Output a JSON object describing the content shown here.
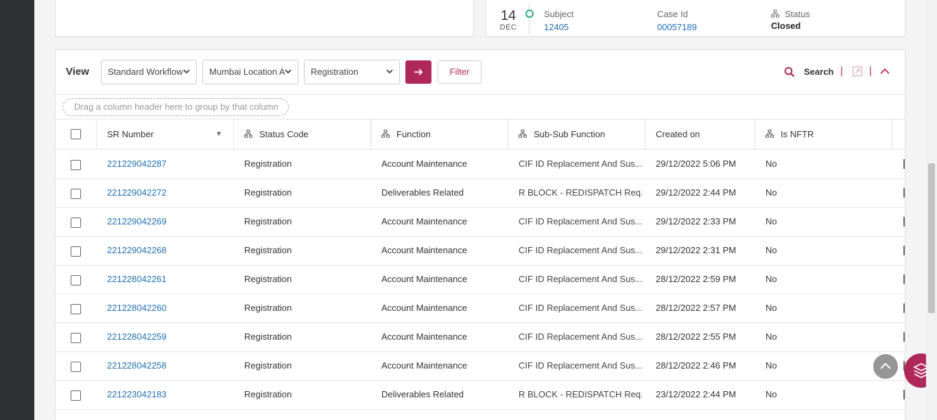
{
  "case_card": {
    "date_day": "14",
    "date_month": "DEC",
    "subject_label": "Subject",
    "subject_value": "12405",
    "case_id_label": "Case Id",
    "case_id_value": "00057189",
    "status_label": "Status",
    "status_value": "Closed"
  },
  "toolbar": {
    "view_label": "View",
    "workflow_select": "Standard Workflow",
    "location_select": "Mumbai Location A",
    "type_select": "Registration",
    "go_icon": "arrow-right-icon",
    "filter_label": "Filter",
    "search_label": "Search"
  },
  "group_hint": "Drag a column header here to group by that column",
  "columns": {
    "sr_number": "SR Number",
    "status_code": "Status Code",
    "function": "Function",
    "sub_sub_function": "Sub-Sub Function",
    "created_on": "Created on",
    "is_nftr": "Is NFTR"
  },
  "rows": [
    {
      "sr": "221229042287",
      "status": "Registration",
      "function": "Account Maintenance",
      "ssf": "CIF ID Replacement And Sus...",
      "created": "29/12/2022 5:06 PM",
      "nftr": "No"
    },
    {
      "sr": "221229042272",
      "status": "Registration",
      "function": "Deliverables Related",
      "ssf": "R BLOCK - REDISPATCH Req...",
      "created": "29/12/2022 2:44 PM",
      "nftr": "No"
    },
    {
      "sr": "221229042269",
      "status": "Registration",
      "function": "Account Maintenance",
      "ssf": "CIF ID Replacement And Sus...",
      "created": "29/12/2022 2:33 PM",
      "nftr": "No"
    },
    {
      "sr": "221229042268",
      "status": "Registration",
      "function": "Account Maintenance",
      "ssf": "CIF ID Replacement And Sus...",
      "created": "29/12/2022 2:31 PM",
      "nftr": "No"
    },
    {
      "sr": "221228042261",
      "status": "Registration",
      "function": "Account Maintenance",
      "ssf": "CIF ID Replacement And Sus...",
      "created": "28/12/2022 2:59 PM",
      "nftr": "No"
    },
    {
      "sr": "221228042260",
      "status": "Registration",
      "function": "Account Maintenance",
      "ssf": "CIF ID Replacement And Sus...",
      "created": "28/12/2022 2:57 PM",
      "nftr": "No"
    },
    {
      "sr": "221228042259",
      "status": "Registration",
      "function": "Account Maintenance",
      "ssf": "CIF ID Replacement And Sus...",
      "created": "28/12/2022 2:55 PM",
      "nftr": "No"
    },
    {
      "sr": "221228042258",
      "status": "Registration",
      "function": "Account Maintenance",
      "ssf": "CIF ID Replacement And Sus...",
      "created": "28/12/2022 2:46 PM",
      "nftr": "No"
    },
    {
      "sr": "221223042183",
      "status": "Registration",
      "function": "Deliverables Related",
      "ssf": "R BLOCK - REDISPATCH Req...",
      "created": "23/12/2022 2:44 PM",
      "nftr": "No"
    }
  ],
  "colors": {
    "accent": "#b0285a",
    "link": "#1f6fb2",
    "status_ring": "#2aa58a"
  }
}
